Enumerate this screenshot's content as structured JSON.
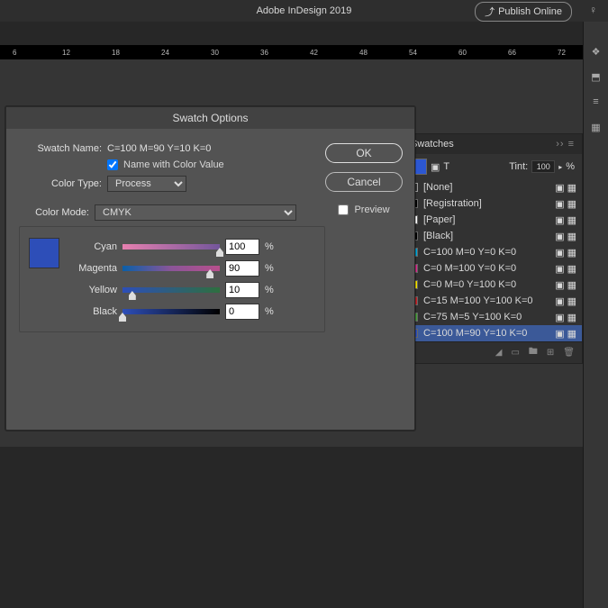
{
  "app": {
    "title": "Adobe InDesign 2019",
    "publish": "Publish Online"
  },
  "ruler": {
    "marks": [
      6,
      12,
      18,
      24,
      30,
      36,
      42,
      48,
      54,
      60,
      66,
      72
    ]
  },
  "dialog": {
    "title": "Swatch Options",
    "swatch_name_label": "Swatch Name:",
    "swatch_name_value": "C=100 M=90 Y=10 K=0",
    "name_with_value": "Name with Color Value",
    "color_type_label": "Color Type:",
    "color_type_value": "Process",
    "color_mode_label": "Color Mode:",
    "color_mode_value": "CMYK",
    "ok": "OK",
    "cancel": "Cancel",
    "preview": "Preview",
    "channels": [
      {
        "label": "Cyan",
        "value": 100,
        "gradient": "linear-gradient(to right,#fff,#00a2d3)",
        "bg": "#d2186e"
      },
      {
        "label": "Magenta",
        "value": 90,
        "gradient": "linear-gradient(to right,#0a5fa8,#8b5598,#b74f8c)",
        "bg": ""
      },
      {
        "label": "Yellow",
        "value": 10,
        "gradient": "linear-gradient(to right,#2d4eb8,#2e6f3f)",
        "bg": ""
      },
      {
        "label": "Black",
        "value": 0,
        "gradient": "linear-gradient(to right,#2d4eb8,#000)",
        "bg": ""
      }
    ],
    "percent": "%"
  },
  "swatches": {
    "title": "Swatches",
    "tint_label": "Tint:",
    "tint_value": "100",
    "tint_unit": "%",
    "items": [
      {
        "name": "[None]",
        "color": "#ffffff00",
        "border": "1px solid #999"
      },
      {
        "name": "[Registration]",
        "color": "#000"
      },
      {
        "name": "[Paper]",
        "color": "#fff"
      },
      {
        "name": "[Black]",
        "color": "#000"
      },
      {
        "name": "C=100 M=0 Y=0 K=0",
        "color": "#00a2d3"
      },
      {
        "name": "C=0 M=100 Y=0 K=0",
        "color": "#d52d8b"
      },
      {
        "name": "C=0 M=0 Y=100 K=0",
        "color": "#f3e100"
      },
      {
        "name": "C=15 M=100 Y=100 K=0",
        "color": "#c0262c"
      },
      {
        "name": "C=75 M=5 Y=100 K=0",
        "color": "#4a9c3d"
      },
      {
        "name": "C=100 M=90 Y=10 K=0",
        "color": "#2d4eb8",
        "selected": true
      }
    ]
  }
}
